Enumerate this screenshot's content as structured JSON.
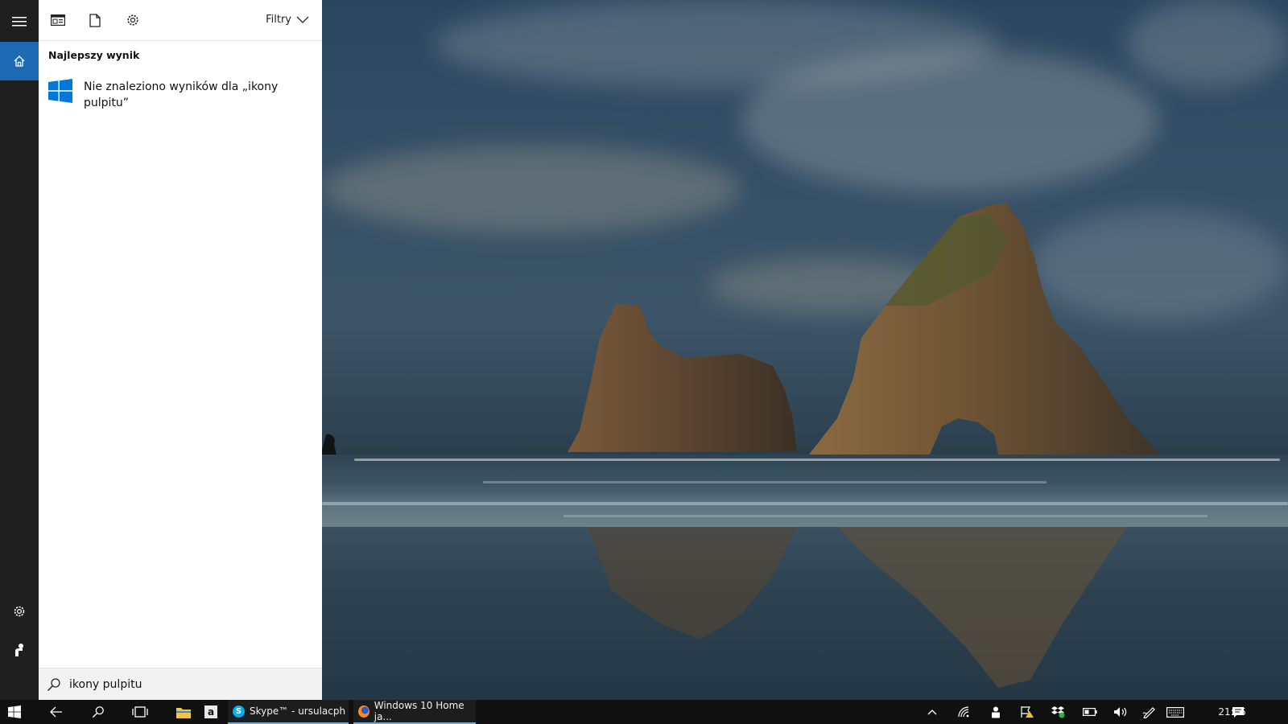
{
  "sidebar": {
    "items": [
      {
        "name": "menu",
        "icon": "hamburger-icon"
      },
      {
        "name": "home",
        "icon": "home-icon",
        "active": true
      },
      {
        "name": "settings",
        "icon": "gear-icon"
      },
      {
        "name": "feedback",
        "icon": "feedback-icon"
      }
    ]
  },
  "panel": {
    "header": {
      "filters_label": "Filtry",
      "icons": [
        "apps-icon",
        "document-icon",
        "settings-icon"
      ]
    },
    "section_title": "Najlepszy wynik",
    "best_result": {
      "icon": "windows-logo-icon",
      "text": "Nie znaleziono wyników dla „ikony pulpitu”"
    },
    "search": {
      "value": "ikony pulpitu",
      "icon": "search-icon"
    }
  },
  "taskbar": {
    "apps": [
      {
        "label": "Skype™ - ursulacph",
        "icon": "skype-icon"
      },
      {
        "label": "Windows 10 Home ja...",
        "icon": "firefox-icon"
      }
    ],
    "clock": "21:15"
  },
  "colors": {
    "accent": "#1f6bb3",
    "windows_blue": "#0078d7",
    "taskbar": "#101010",
    "sidebar": "#1f1f1f"
  }
}
